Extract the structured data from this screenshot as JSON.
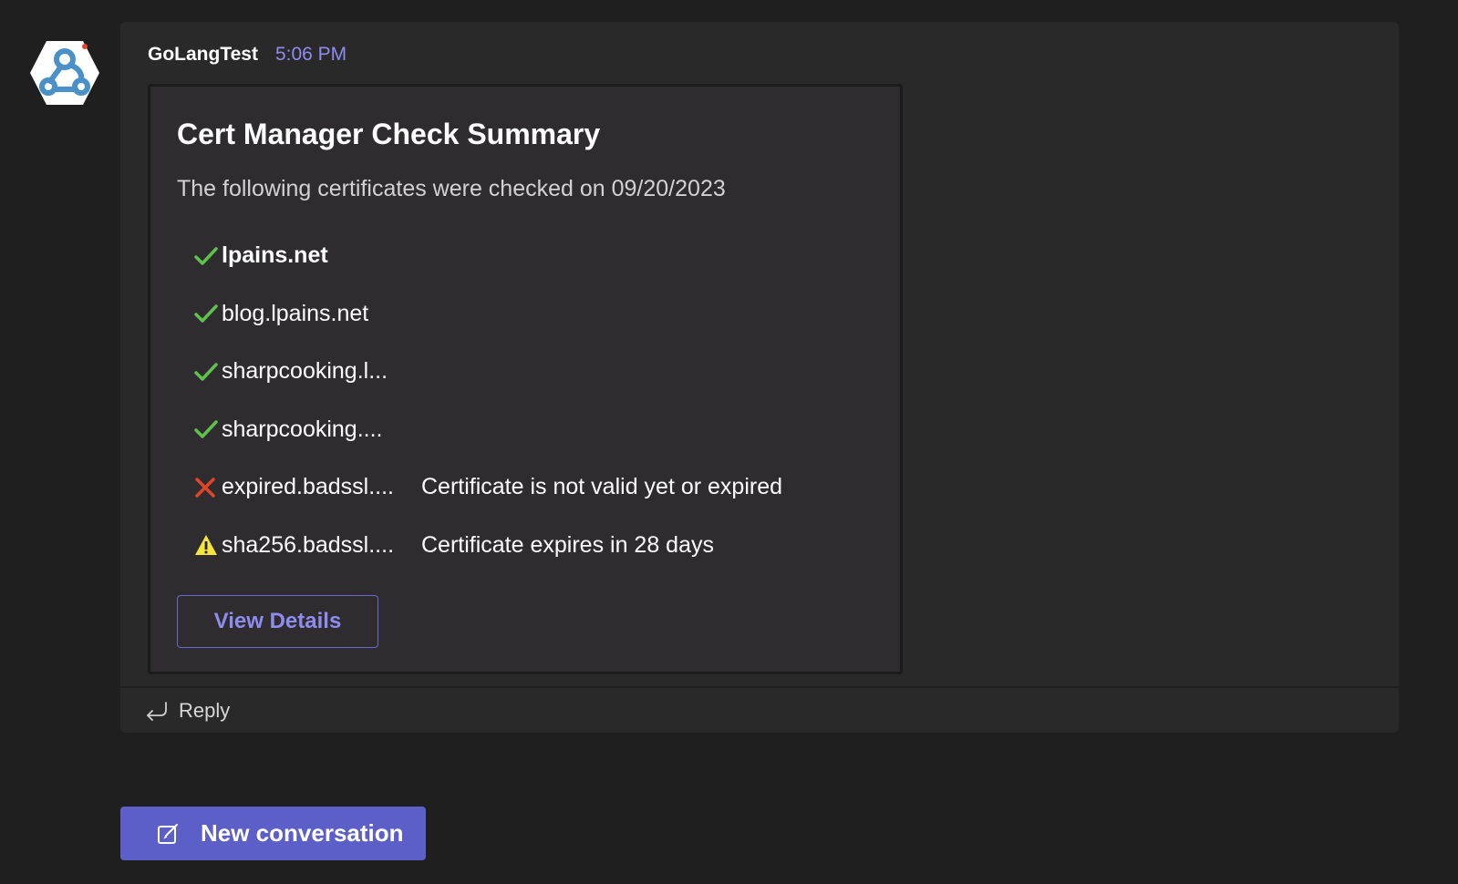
{
  "message": {
    "sender": "GoLangTest",
    "timestamp": "5:06 PM",
    "avatar_icon": "webhook-icon"
  },
  "card": {
    "title": "Cert Manager Check Summary",
    "subtitle": "The following certificates were checked on 09/20/2023",
    "certificates": [
      {
        "name": "lpains.net",
        "status": "ok",
        "icon": "check-icon",
        "note": ""
      },
      {
        "name": "blog.lpains.net",
        "status": "ok",
        "icon": "check-icon",
        "note": ""
      },
      {
        "name": "sharpcooking.l...",
        "status": "ok",
        "icon": "check-icon",
        "note": ""
      },
      {
        "name": "sharpcooking....",
        "status": "ok",
        "icon": "check-icon",
        "note": ""
      },
      {
        "name": "expired.badssl....",
        "status": "error",
        "icon": "cross-icon",
        "note": "Certificate is not valid yet or expired"
      },
      {
        "name": "sha256.badssl....",
        "status": "warning",
        "icon": "warning-icon",
        "note": "Certificate expires in 28 days"
      }
    ],
    "action_label": "View Details"
  },
  "reply": {
    "label": "Reply",
    "icon": "reply-arrow-icon"
  },
  "footer": {
    "new_conversation_label": "New conversation",
    "icon": "compose-icon"
  },
  "colors": {
    "background": "#1f1f1f",
    "message_bg": "#292929",
    "card_bg": "#2e2c2f",
    "accent": "#5b5fc7",
    "link": "#8f8cf0",
    "ok": "#5ec14a",
    "error": "#e0452c",
    "warning": "#f5e63d"
  }
}
